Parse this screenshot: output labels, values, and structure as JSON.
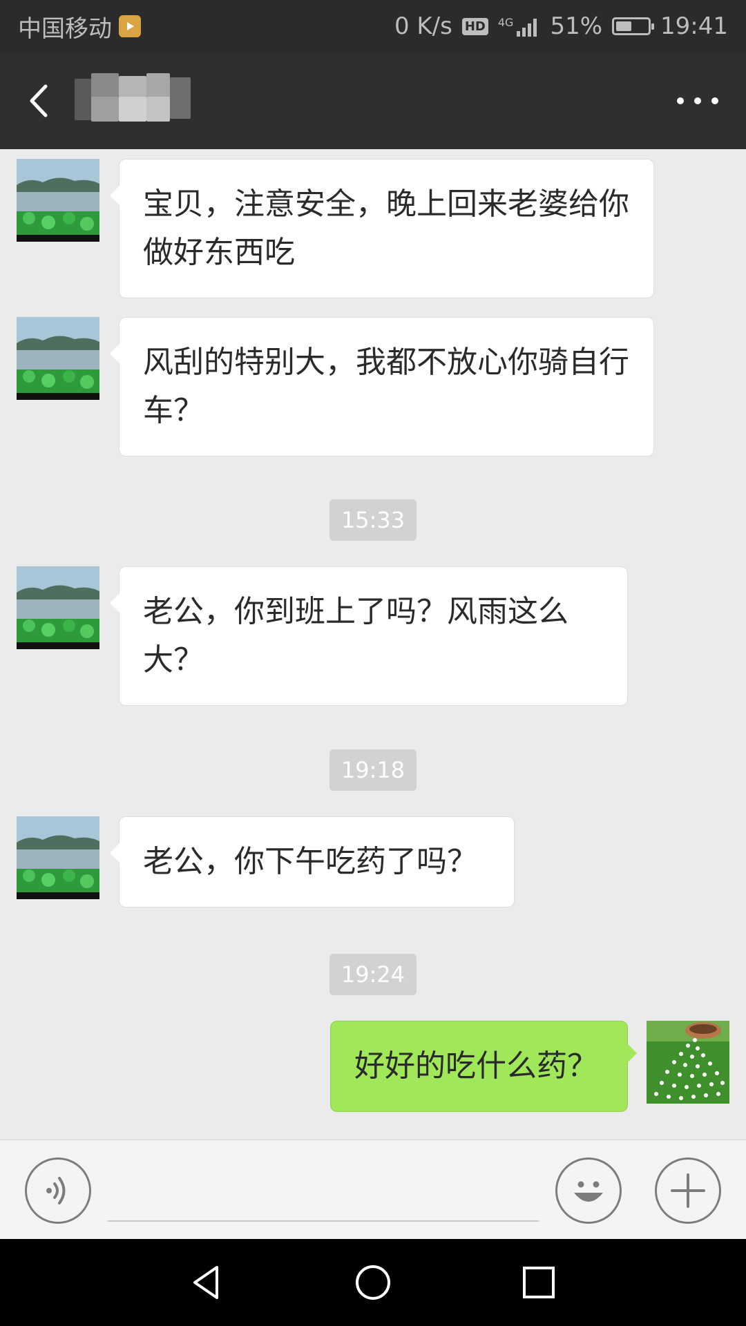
{
  "status_bar": {
    "carrier": "中国移动",
    "speed": "0 K/s",
    "hd_label": "HD",
    "network": "4G",
    "battery_text": "51%",
    "battery_level": 0.51,
    "time": "19:41"
  },
  "header": {
    "back_icon": "chevron-left-icon",
    "more_icon": "more-dots-icon"
  },
  "messages": [
    {
      "side": "left",
      "text": "宝贝，注意安全，晚上回来老婆给你做好东西吃"
    },
    {
      "side": "left",
      "text": "风刮的特别大，我都不放心你骑自行车？"
    },
    {
      "type": "time",
      "text": "15:33"
    },
    {
      "side": "left",
      "text": "老公，你到班上了吗？风雨这么大？"
    },
    {
      "type": "time",
      "text": "19:18"
    },
    {
      "side": "left",
      "text": "老公，你下午吃药了吗？"
    },
    {
      "type": "time",
      "text": "19:24"
    },
    {
      "side": "right",
      "text": "好好的吃什么药？"
    }
  ],
  "input_bar": {
    "voice_icon": "voice-icon",
    "emoji_icon": "emoji-icon",
    "plus_icon": "plus-icon",
    "input_value": ""
  },
  "nav_bar": {
    "back_icon": "triangle-back-icon",
    "home_icon": "circle-home-icon",
    "recents_icon": "square-recents-icon"
  },
  "colors": {
    "status_bg": "#2b2b2b",
    "header_bg": "#2f2f2f",
    "chat_bg": "#ebebeb",
    "bubble_incoming": "#ffffff",
    "bubble_outgoing": "#a0e75a",
    "timestamp_bg": "#d2d2d2"
  }
}
